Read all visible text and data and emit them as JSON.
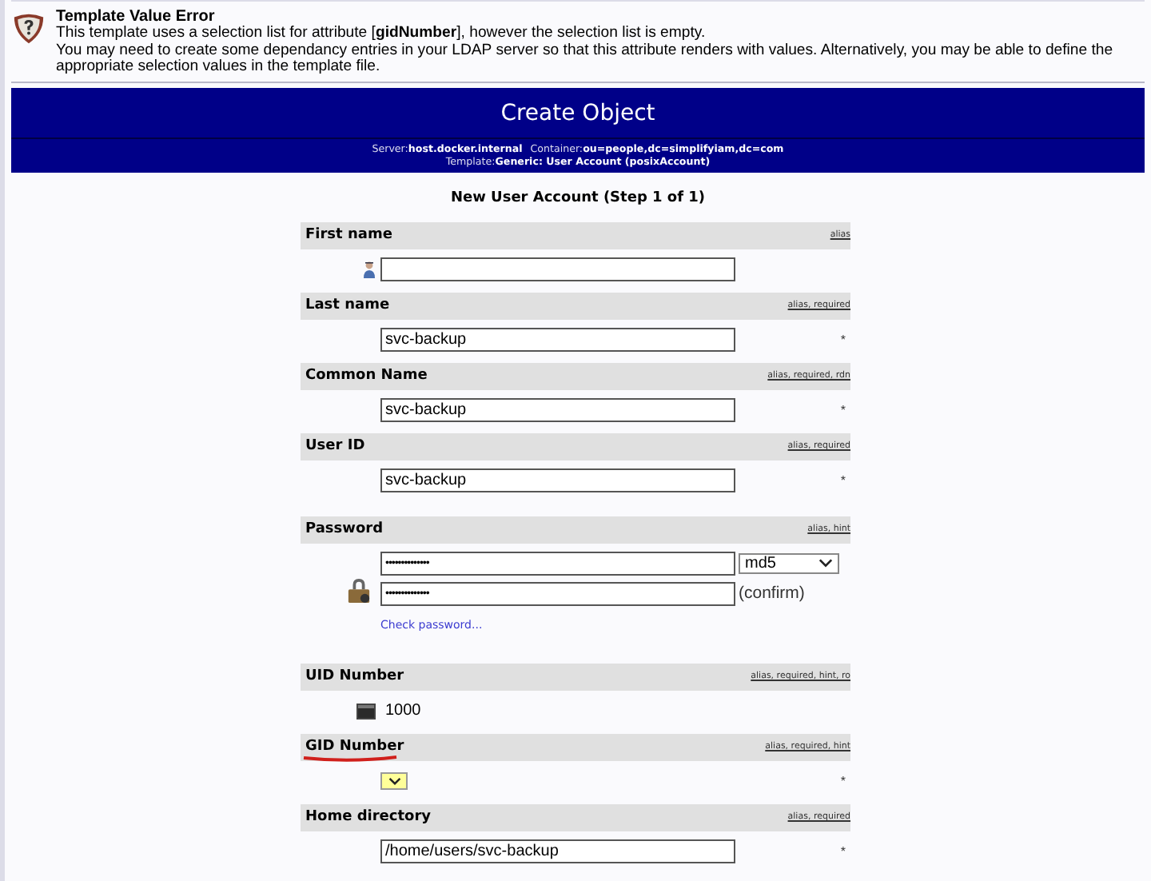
{
  "error": {
    "title": "Template Value Error",
    "lines": [
      "This template uses a selection list for attribute [**gidNumber**], however the selection list is empty.",
      "You may need to create some dependancy entries in your LDAP server so that this attribute renders with values. Alternatively, you may be able to define the appropriate selection values in the template file."
    ]
  },
  "header": {
    "title": "Create Object",
    "server_label": "Server:",
    "server": "host.docker.internal",
    "container_label": "Container:",
    "container": "ou=people,dc=simplifyiam,dc=com",
    "template_label": "Template:",
    "template": "Generic: User Account (posixAccount)"
  },
  "form_title": "New User Account (Step 1 of 1)",
  "fields": [
    {
      "kind": "person_text",
      "label": "First name",
      "hints": "alias"
    },
    {
      "kind": "text",
      "label": "Last name",
      "hints": "alias, required",
      "value": "svc-backup",
      "required_mark": "*"
    },
    {
      "kind": "text",
      "label": "Common Name",
      "hints": "alias, required, rdn",
      "value": "svc-backup",
      "required_mark": "*"
    },
    {
      "kind": "text",
      "label": "User ID",
      "hints": "alias, required",
      "value": "svc-backup",
      "required_mark": "*"
    },
    {
      "kind": "password",
      "label": "Password",
      "hints": "alias, hint",
      "value": "••••••••••••••",
      "confirm_value": "••••••••••••••",
      "hash": "md5",
      "confirm_label": "(confirm)",
      "check_link": "Check password..."
    },
    {
      "kind": "number",
      "label": "UID Number",
      "hints": "alias, required, hint, ro",
      "value": "1000"
    },
    {
      "kind": "select",
      "label": "GID Number",
      "hints": "alias, required, hint",
      "annotated": true,
      "required_mark": "*"
    },
    {
      "kind": "text",
      "label": "Home directory",
      "hints": "alias, required",
      "value": "/home/users/svc-backup",
      "required_mark": "*"
    }
  ]
}
